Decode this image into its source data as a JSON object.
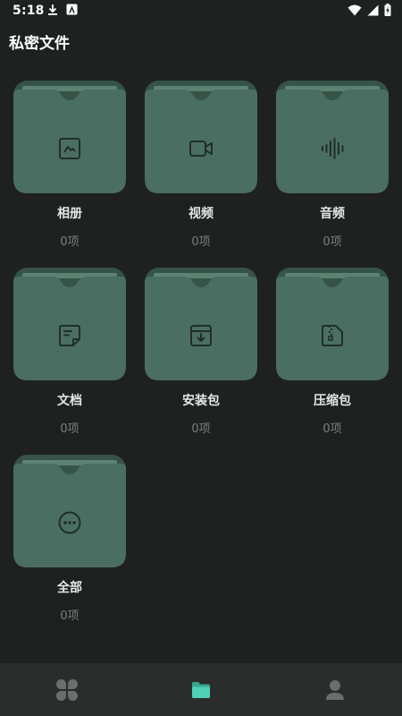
{
  "status_bar": {
    "time": "5:18",
    "icons": [
      "download-icon",
      "app-notification-icon",
      "wifi-icon",
      "cellular-signal-icon",
      "battery-charging-icon"
    ]
  },
  "page": {
    "title": "私密文件"
  },
  "folders": [
    {
      "label": "相册",
      "count": "0项",
      "icon": "image-icon"
    },
    {
      "label": "视频",
      "count": "0项",
      "icon": "video-camera-icon"
    },
    {
      "label": "音频",
      "count": "0项",
      "icon": "audio-waveform-icon"
    },
    {
      "label": "文档",
      "count": "0项",
      "icon": "document-icon"
    },
    {
      "label": "安装包",
      "count": "0项",
      "icon": "package-download-icon"
    },
    {
      "label": "压缩包",
      "count": "0项",
      "icon": "zip-file-icon"
    },
    {
      "label": "全部",
      "count": "0项",
      "icon": "more-dots-icon"
    }
  ],
  "bottom_nav": {
    "items": [
      {
        "icon": "clover-grid-icon",
        "active": false
      },
      {
        "icon": "folder-icon",
        "active": true
      },
      {
        "icon": "user-icon",
        "active": false
      }
    ]
  },
  "colors": {
    "background": "#1e2120",
    "folder_body": "#4b6e62",
    "folder_back": "#355348",
    "folder_icon": "#1f2e29",
    "label": "#e6e6e6",
    "count": "#7b7f7d",
    "nav_background": "#2a2d2c",
    "nav_active": "#4fd1b5",
    "nav_inactive": "#6b6e6d"
  }
}
